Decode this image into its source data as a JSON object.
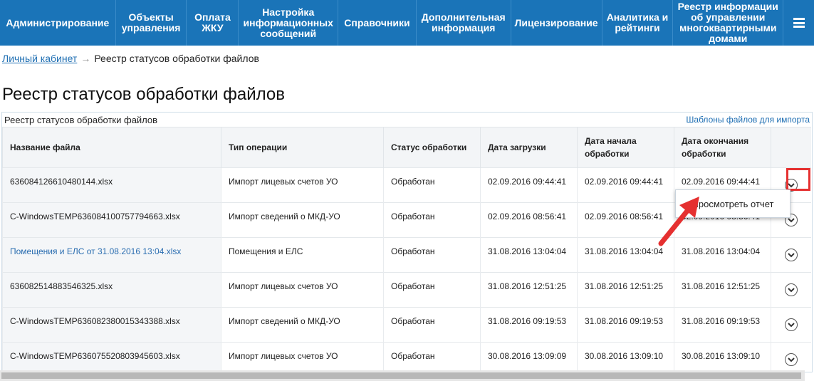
{
  "nav": {
    "items": [
      {
        "label": "Администрирование"
      },
      {
        "label": "Объекты\nуправления"
      },
      {
        "label": "Оплата\nЖКУ"
      },
      {
        "label": "Настройка\nинформационных\nсообщений"
      },
      {
        "label": "Справочники"
      },
      {
        "label": "Дополнительная\nинформация"
      },
      {
        "label": "Лицензирование"
      },
      {
        "label": "Аналитика и\nрейтинги"
      },
      {
        "label": "Реестр информации\nоб управлении\nмногоквартирными\nдомами"
      }
    ],
    "menu_icon": "hamburger-icon"
  },
  "breadcrumb": {
    "home": "Личный кабинет",
    "separator": "→",
    "current": "Реестр статусов обработки файлов"
  },
  "page_title": "Реестр статусов обработки файлов",
  "panel": {
    "title": "Реестр статусов обработки файлов",
    "templates_link": "Шаблоны файлов для импорта"
  },
  "table": {
    "headers": [
      "Название файла",
      "Тип операции",
      "Статус обработки",
      "Дата загрузки",
      "Дата начала обработки",
      "Дата окончания обработки"
    ],
    "rows": [
      {
        "file": "636084126610480144.xlsx",
        "op": "Импорт лицевых счетов УО",
        "status": "Обработан",
        "uploaded": "02.09.2016 09:44:41",
        "start": "02.09.2016 09:44:41",
        "end": "02.09.2016 09:44:41"
      },
      {
        "file": "C-WindowsTEMP636084100757794663.xlsx",
        "op": "Импорт сведений о МКД-УО",
        "status": "Обработан",
        "uploaded": "02.09.2016 08:56:41",
        "start": "02.09.2016 08:56:41",
        "end": "02.09.2016 08:56:41"
      },
      {
        "file": "Помещения и ЕЛС от 31.08.2016 13:04.xlsx",
        "op": "Помещения и ЕЛС",
        "status": "Обработан",
        "uploaded": "31.08.2016 13:04:04",
        "start": "31.08.2016 13:04:04",
        "end": "31.08.2016 13:04:04"
      },
      {
        "file": "636082514883546325.xlsx",
        "op": "Импорт лицевых счетов УО",
        "status": "Обработан",
        "uploaded": "31.08.2016 12:51:25",
        "start": "31.08.2016 12:51:25",
        "end": "31.08.2016 12:51:25"
      },
      {
        "file": "C-WindowsTEMP636082380015343388.xlsx",
        "op": "Импорт сведений о МКД-УО",
        "status": "Обработан",
        "uploaded": "31.08.2016 09:19:53",
        "start": "31.08.2016 09:19:53",
        "end": "31.08.2016 09:19:53"
      },
      {
        "file": "C-WindowsTEMP636075520803945603.xlsx",
        "op": "Импорт лицевых счетов УО",
        "status": "Обработан",
        "uploaded": "30.08.2016 13:09:09",
        "start": "30.08.2016 13:09:10",
        "end": "30.08.2016 13:09:10"
      }
    ]
  },
  "popup": {
    "view_report": "Просмотреть отчет"
  },
  "colors": {
    "nav_bg": "#1a74b8",
    "link": "#1f6fb3",
    "highlight": "#e53030"
  }
}
